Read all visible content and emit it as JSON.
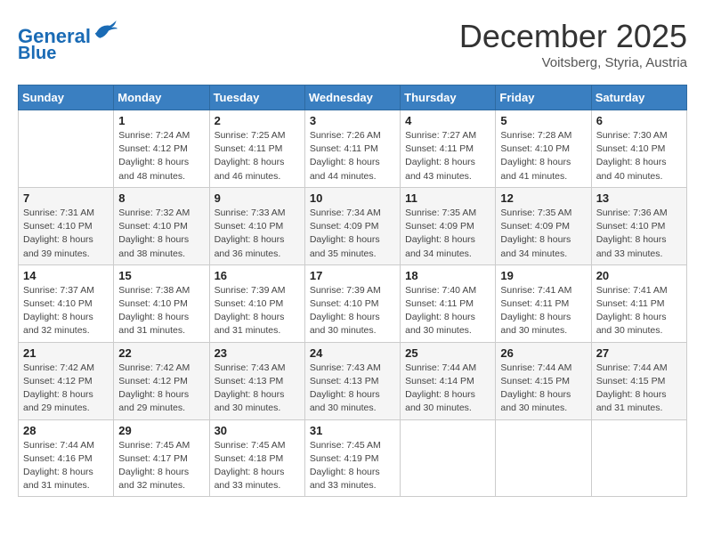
{
  "header": {
    "logo_line1": "General",
    "logo_line2": "Blue",
    "month_title": "December 2025",
    "subtitle": "Voitsberg, Styria, Austria"
  },
  "days_of_week": [
    "Sunday",
    "Monday",
    "Tuesday",
    "Wednesday",
    "Thursday",
    "Friday",
    "Saturday"
  ],
  "weeks": [
    [
      {
        "day": "",
        "info": ""
      },
      {
        "day": "1",
        "info": "Sunrise: 7:24 AM\nSunset: 4:12 PM\nDaylight: 8 hours\nand 48 minutes."
      },
      {
        "day": "2",
        "info": "Sunrise: 7:25 AM\nSunset: 4:11 PM\nDaylight: 8 hours\nand 46 minutes."
      },
      {
        "day": "3",
        "info": "Sunrise: 7:26 AM\nSunset: 4:11 PM\nDaylight: 8 hours\nand 44 minutes."
      },
      {
        "day": "4",
        "info": "Sunrise: 7:27 AM\nSunset: 4:11 PM\nDaylight: 8 hours\nand 43 minutes."
      },
      {
        "day": "5",
        "info": "Sunrise: 7:28 AM\nSunset: 4:10 PM\nDaylight: 8 hours\nand 41 minutes."
      },
      {
        "day": "6",
        "info": "Sunrise: 7:30 AM\nSunset: 4:10 PM\nDaylight: 8 hours\nand 40 minutes."
      }
    ],
    [
      {
        "day": "7",
        "info": "Sunrise: 7:31 AM\nSunset: 4:10 PM\nDaylight: 8 hours\nand 39 minutes."
      },
      {
        "day": "8",
        "info": "Sunrise: 7:32 AM\nSunset: 4:10 PM\nDaylight: 8 hours\nand 38 minutes."
      },
      {
        "day": "9",
        "info": "Sunrise: 7:33 AM\nSunset: 4:10 PM\nDaylight: 8 hours\nand 36 minutes."
      },
      {
        "day": "10",
        "info": "Sunrise: 7:34 AM\nSunset: 4:09 PM\nDaylight: 8 hours\nand 35 minutes."
      },
      {
        "day": "11",
        "info": "Sunrise: 7:35 AM\nSunset: 4:09 PM\nDaylight: 8 hours\nand 34 minutes."
      },
      {
        "day": "12",
        "info": "Sunrise: 7:35 AM\nSunset: 4:09 PM\nDaylight: 8 hours\nand 34 minutes."
      },
      {
        "day": "13",
        "info": "Sunrise: 7:36 AM\nSunset: 4:10 PM\nDaylight: 8 hours\nand 33 minutes."
      }
    ],
    [
      {
        "day": "14",
        "info": "Sunrise: 7:37 AM\nSunset: 4:10 PM\nDaylight: 8 hours\nand 32 minutes."
      },
      {
        "day": "15",
        "info": "Sunrise: 7:38 AM\nSunset: 4:10 PM\nDaylight: 8 hours\nand 31 minutes."
      },
      {
        "day": "16",
        "info": "Sunrise: 7:39 AM\nSunset: 4:10 PM\nDaylight: 8 hours\nand 31 minutes."
      },
      {
        "day": "17",
        "info": "Sunrise: 7:39 AM\nSunset: 4:10 PM\nDaylight: 8 hours\nand 30 minutes."
      },
      {
        "day": "18",
        "info": "Sunrise: 7:40 AM\nSunset: 4:11 PM\nDaylight: 8 hours\nand 30 minutes."
      },
      {
        "day": "19",
        "info": "Sunrise: 7:41 AM\nSunset: 4:11 PM\nDaylight: 8 hours\nand 30 minutes."
      },
      {
        "day": "20",
        "info": "Sunrise: 7:41 AM\nSunset: 4:11 PM\nDaylight: 8 hours\nand 30 minutes."
      }
    ],
    [
      {
        "day": "21",
        "info": "Sunrise: 7:42 AM\nSunset: 4:12 PM\nDaylight: 8 hours\nand 29 minutes."
      },
      {
        "day": "22",
        "info": "Sunrise: 7:42 AM\nSunset: 4:12 PM\nDaylight: 8 hours\nand 29 minutes."
      },
      {
        "day": "23",
        "info": "Sunrise: 7:43 AM\nSunset: 4:13 PM\nDaylight: 8 hours\nand 30 minutes."
      },
      {
        "day": "24",
        "info": "Sunrise: 7:43 AM\nSunset: 4:13 PM\nDaylight: 8 hours\nand 30 minutes."
      },
      {
        "day": "25",
        "info": "Sunrise: 7:44 AM\nSunset: 4:14 PM\nDaylight: 8 hours\nand 30 minutes."
      },
      {
        "day": "26",
        "info": "Sunrise: 7:44 AM\nSunset: 4:15 PM\nDaylight: 8 hours\nand 30 minutes."
      },
      {
        "day": "27",
        "info": "Sunrise: 7:44 AM\nSunset: 4:15 PM\nDaylight: 8 hours\nand 31 minutes."
      }
    ],
    [
      {
        "day": "28",
        "info": "Sunrise: 7:44 AM\nSunset: 4:16 PM\nDaylight: 8 hours\nand 31 minutes."
      },
      {
        "day": "29",
        "info": "Sunrise: 7:45 AM\nSunset: 4:17 PM\nDaylight: 8 hours\nand 32 minutes."
      },
      {
        "day": "30",
        "info": "Sunrise: 7:45 AM\nSunset: 4:18 PM\nDaylight: 8 hours\nand 33 minutes."
      },
      {
        "day": "31",
        "info": "Sunrise: 7:45 AM\nSunset: 4:19 PM\nDaylight: 8 hours\nand 33 minutes."
      },
      {
        "day": "",
        "info": ""
      },
      {
        "day": "",
        "info": ""
      },
      {
        "day": "",
        "info": ""
      }
    ]
  ]
}
